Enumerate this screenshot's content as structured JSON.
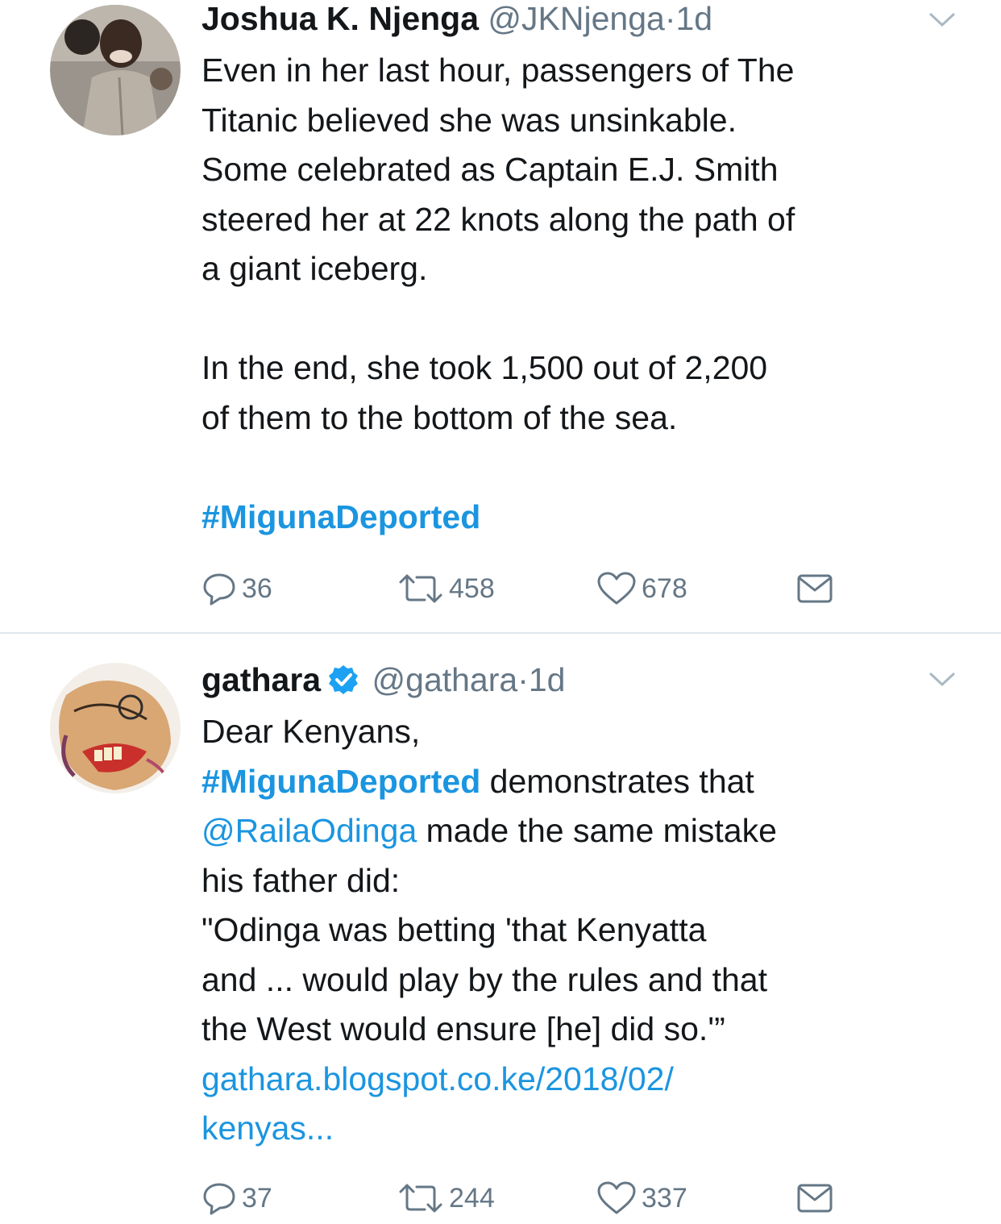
{
  "tweets": [
    {
      "name": "Joshua K. Njenga",
      "handle": "@JKNjenga",
      "separator": "·",
      "time": "1d",
      "avatar_icon": "profile-photo",
      "body": {
        "line1": "Even in her last hour, passengers of The",
        "line2": "Titanic believed she was unsinkable.",
        "line3": "Some celebrated as Captain E.J. Smith",
        "line4": "steered her at 22 knots along the path of",
        "line5": "a giant iceberg.",
        "line6": "In the end, she took 1,500 out of 2,200",
        "line7": "of them to the bottom of the sea.",
        "hashtag": "#MigunaDeported"
      },
      "replies": "36",
      "retweets": "458",
      "likes": "678"
    },
    {
      "name": "gathara",
      "verified": true,
      "handle": "@gathara",
      "separator": "·",
      "time": "1d",
      "avatar_icon": "caricature-avatar",
      "body": {
        "line1": "Dear Kenyans,",
        "hashtag": "#MigunaDeported",
        "line2_rest": " demonstrates that",
        "mention": "@RailaOdinga",
        "line3_rest": " made the same mistake",
        "line4": "his father did:",
        "line5": "\"Odinga was betting 'that Kenyatta",
        "line6": "and ... would play by the rules and that",
        "line7": "the West would ensure [he] did so.'”",
        "link_line1": "gathara.blogspot.co.ke/2018/02/",
        "link_line2": "kenyas..."
      },
      "replies": "37",
      "retweets": "244",
      "likes": "337"
    }
  ],
  "colors": {
    "link": "#1b95e0",
    "muted": "#657786",
    "text": "#14171a",
    "divider": "#e1e8ed"
  },
  "icons": [
    "chevron-down-icon",
    "reply-icon",
    "retweet-icon",
    "like-icon",
    "direct-message-icon",
    "verified-badge-icon"
  ]
}
